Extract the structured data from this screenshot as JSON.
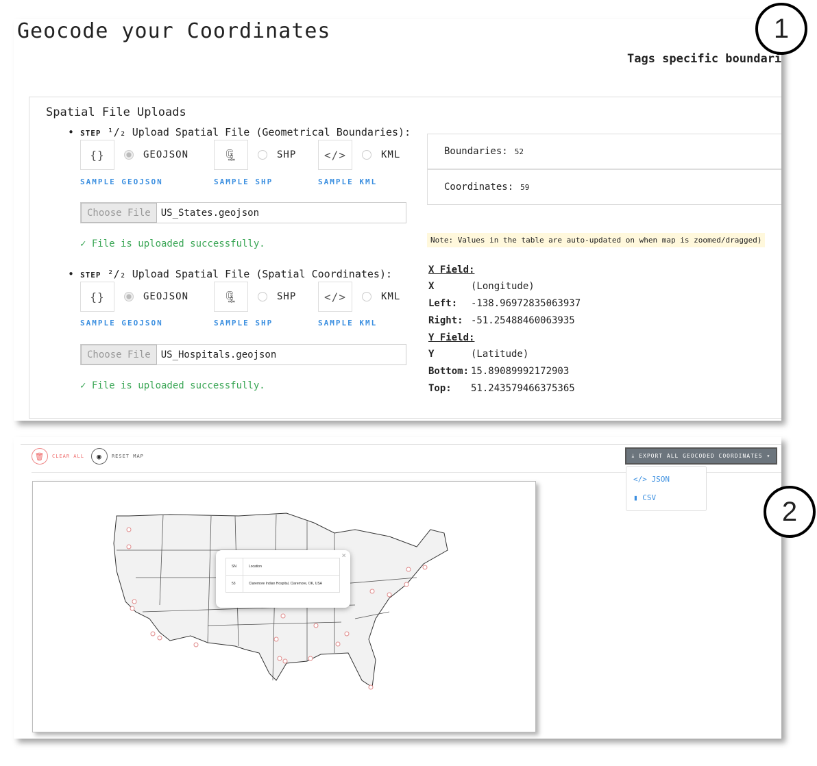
{
  "title": "Geocode your Coordinates",
  "tags_text": "Tags specific boundari",
  "uploads": {
    "title": "Spatial File Uploads",
    "steps": [
      {
        "step": "STEP",
        "frac": "¹/₂",
        "label": "Upload Spatial File (Geometrical Boundaries):",
        "file_button": "Choose File",
        "file_name": "US_States.geojson",
        "status": "✓ File is uploaded successfully."
      },
      {
        "step": "STEP",
        "frac": "²/₂",
        "label": "Upload Spatial File (Spatial Coordinates):",
        "file_button": "Choose File",
        "file_name": "US_Hospitals.geojson",
        "status": "✓ File is uploaded successfully."
      }
    ],
    "formats": [
      "GEOJSON",
      "SHP",
      "KML"
    ],
    "samples": [
      "SAMPLE GEOJSON",
      "SAMPLE SHP",
      "SAMPLE KML"
    ]
  },
  "stats": {
    "boundaries_label": "Boundaries:",
    "boundaries": "52",
    "coordinates_label": "Coordinates:",
    "coordinates": "59"
  },
  "note": "Note: Values in the table are auto-updated on when map is zoomed/dragged)",
  "fields": {
    "x_title": "X Field:",
    "x_label": "X",
    "x_value": "(Longitude)",
    "left_label": "Left:",
    "left": "-138.96972835063937",
    "right_label": "Right:",
    "right": "-51.25488460063935",
    "y_title": "Y Field:",
    "y_label": "Y",
    "y_value": "(Latitude)",
    "bottom_label": "Bottom:",
    "bottom": "15.89089992172903",
    "top_label": "Top:",
    "top": "51.243579466375365"
  },
  "toolbar": {
    "clear": "CLEAR ALL",
    "reset": "RESET MAP",
    "export": "EXPORT ALL GEOCODED COORDINATES",
    "menu": [
      "JSON",
      "CSV"
    ]
  },
  "popup": {
    "headers": [
      "SN",
      "Location"
    ],
    "row": [
      "53",
      "Claremore Indian Hospital, Claremore, OK, USA"
    ]
  },
  "callouts": [
    "1",
    "2"
  ]
}
